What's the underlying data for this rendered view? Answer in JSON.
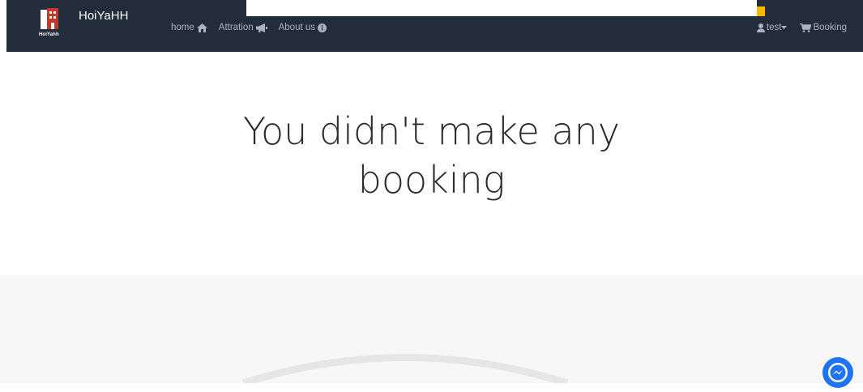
{
  "navbar": {
    "brand": "HoiYaHH",
    "logo_text": "HoiYahh",
    "links": [
      {
        "label": "home",
        "icon": "home-icon"
      },
      {
        "label": "Attration",
        "icon": "bullhorn-icon"
      },
      {
        "label": "About us",
        "icon": "info-circle-icon"
      }
    ],
    "user_label": "test",
    "booking_label": "Booking",
    "colors": {
      "bg": "#232c3b",
      "link": "#aab2bd",
      "accent": "#f5b800"
    }
  },
  "main": {
    "message_line1": "You didn't make any",
    "message_line2": "booking"
  },
  "messenger": {
    "icon": "messenger-icon",
    "color": "#1e74f5"
  }
}
